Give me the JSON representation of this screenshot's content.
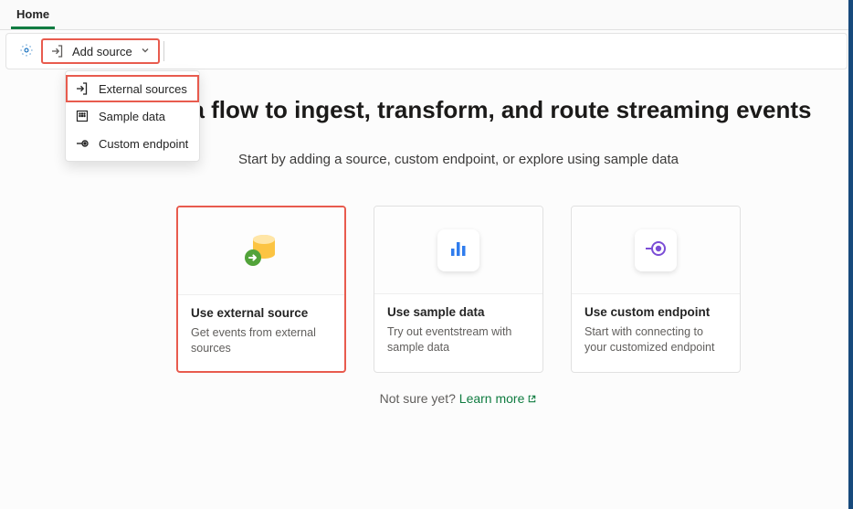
{
  "tabs": {
    "home": "Home"
  },
  "toolbar": {
    "add_source_label": "Add source"
  },
  "dropdown": {
    "items": [
      {
        "label": "External sources"
      },
      {
        "label": "Sample data"
      },
      {
        "label": "Custom endpoint"
      }
    ]
  },
  "page": {
    "heading": "Design a flow to ingest, transform, and route streaming events",
    "sub": "Start by adding a source, custom endpoint, or explore using sample data"
  },
  "cards": [
    {
      "title": "Use external source",
      "desc": "Get events from external sources"
    },
    {
      "title": "Use sample data",
      "desc": "Try out eventstream with sample data"
    },
    {
      "title": "Use custom endpoint",
      "desc": "Start with connecting to your customized endpoint"
    }
  ],
  "footer": {
    "prefix": "Not sure yet? ",
    "link": "Learn more"
  }
}
